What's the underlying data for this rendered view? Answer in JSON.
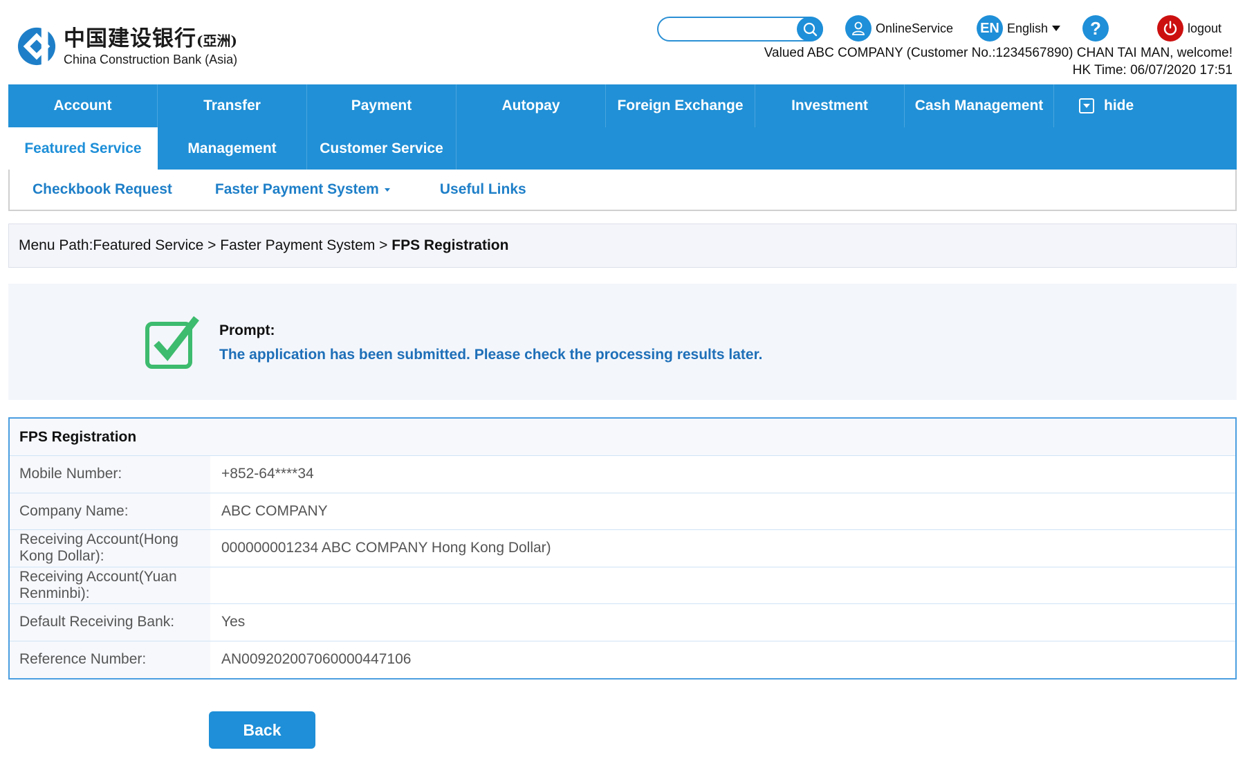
{
  "brand": {
    "name_cn": "中国建设银行",
    "name_cn_suffix": "(亞洲)",
    "name_en": "China Construction Bank (Asia)",
    "logo_color": "#1e7fc8"
  },
  "header": {
    "search": {
      "value": "",
      "placeholder": ""
    },
    "online_service": "OnlineService",
    "language": {
      "badge": "EN",
      "label": "English"
    },
    "help_icon": "?",
    "logout": "logout",
    "welcome": "Valued ABC COMPANY (Customer No.:1234567890) CHAN TAI MAN, welcome!",
    "time": "HK Time: 06/07/2020 17:51"
  },
  "nav": {
    "row1": [
      "Account",
      "Transfer",
      "Payment",
      "Autopay",
      "Foreign Exchange",
      "Investment",
      "Cash Management"
    ],
    "hide_label": "hide",
    "row2": [
      "Featured Service",
      "Management",
      "Customer Service"
    ],
    "sub": [
      "Checkbook Request",
      "Faster Payment System",
      "Useful Links"
    ]
  },
  "breadcrumb": {
    "prefix": "Menu Path:Featured Service > Faster Payment System > ",
    "current": "FPS Registration"
  },
  "prompt": {
    "title": "Prompt:",
    "message": "The application has been submitted. Please check the processing results later."
  },
  "details": {
    "title": "FPS Registration",
    "rows": [
      {
        "label": "Mobile Number:",
        "value": "+852-64****34"
      },
      {
        "label": "Company Name:",
        "value": "ABC COMPANY"
      },
      {
        "label": "Receiving Account(Hong Kong Dollar):",
        "value": "000000001234 ABC COMPANY Hong Kong Dollar)"
      },
      {
        "label": "Receiving Account(Yuan Renminbi):",
        "value": ""
      },
      {
        "label": "Default Receiving Bank:",
        "value": "Yes"
      },
      {
        "label": "Reference Number:",
        "value": "AN009202007060000447106"
      }
    ]
  },
  "actions": {
    "back": "Back"
  },
  "colors": {
    "primary": "#2190d6",
    "link": "#1e7fc8",
    "success": "#3dbb6e",
    "logout": "#cc1010"
  }
}
